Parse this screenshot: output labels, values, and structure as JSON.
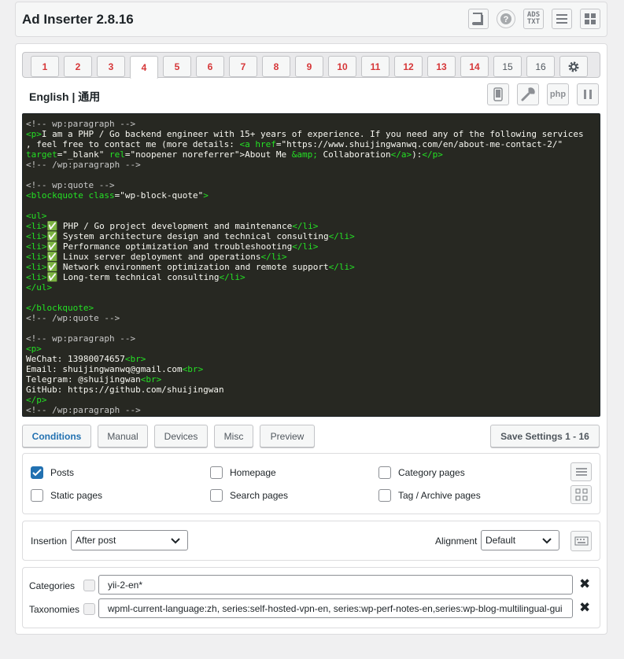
{
  "app": {
    "title": "Ad Inserter 2.8.16"
  },
  "header_icons": [
    "book-icon",
    "help-icon",
    "ads-txt-icon",
    "list-icon",
    "grid-icon"
  ],
  "ads_txt_label_1": "ADS",
  "ads_txt_label_2": "TXT",
  "tabs": [
    "1",
    "2",
    "3",
    "4",
    "5",
    "6",
    "7",
    "8",
    "9",
    "10",
    "11",
    "12",
    "13",
    "14",
    "15",
    "16"
  ],
  "active_tab": "4",
  "block": {
    "name": "English | 通用",
    "php_label": "php"
  },
  "code_lines": [
    "<!-- wp:paragraph -->",
    "<p>I am a PHP / Go backend engineer with 15+ years of experience. If you need any of the following services",
    ", feel free to contact me (more details: <a href=\"https://www.shuijingwanwq.com/en/about-me-contact-2/\"",
    "target=\"_blank\" rel=\"noopener noreferrer\">About Me &amp; Collaboration</a>):</p>",
    "<!-- /wp:paragraph -->",
    "",
    "<!-- wp:quote -->",
    "<blockquote class=\"wp-block-quote\">",
    "",
    "<ul>",
    "<li>✅ PHP / Go project development and maintenance</li>",
    "<li>✅ System architecture design and technical consulting</li>",
    "<li>✅ Performance optimization and troubleshooting</li>",
    "<li>✅ Linux server deployment and operations</li>",
    "<li>✅ Network environment optimization and remote support</li>",
    "<li>✅ Long-term technical consulting</li>",
    "</ul>",
    "",
    "</blockquote>",
    "<!-- /wp:quote -->",
    "",
    "<!-- wp:paragraph -->",
    "<p>",
    "WeChat: 13980074657<br>",
    "Email: shuijingwanwq@gmail.com<br>",
    "Telegram: @shuijingwan<br>",
    "GitHub: https://github.com/shuijingwan",
    "</p>",
    "<!-- /wp:paragraph -->"
  ],
  "buttons": {
    "conditions": "Conditions",
    "manual": "Manual",
    "devices": "Devices",
    "misc": "Misc",
    "preview": "Preview",
    "save": "Save Settings 1 - 16"
  },
  "conditions": {
    "posts": {
      "label": "Posts",
      "checked": true
    },
    "homepage": {
      "label": "Homepage",
      "checked": false
    },
    "category_pages": {
      "label": "Category pages",
      "checked": false
    },
    "static_pages": {
      "label": "Static pages",
      "checked": false
    },
    "search_pages": {
      "label": "Search pages",
      "checked": false
    },
    "tag_archive_pages": {
      "label": "Tag / Archive pages",
      "checked": false
    }
  },
  "insertion": {
    "label": "Insertion",
    "value": "After post"
  },
  "alignment": {
    "label": "Alignment",
    "value": "Default"
  },
  "categories": {
    "label": "Categories",
    "value": "yii-2-en*"
  },
  "taxonomies": {
    "label": "Taxonomies",
    "value": "wpml-current-language:zh, series:self-hosted-vpn-en, series:wp-perf-notes-en,series:wp-blog-multilingual-gui"
  },
  "remove_symbol": "✖"
}
